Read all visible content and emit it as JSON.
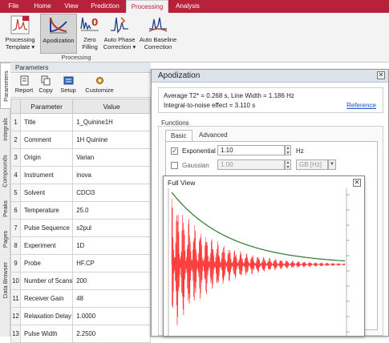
{
  "ribbon": {
    "tabs": [
      "File",
      "Home",
      "View",
      "Prediction",
      "Processing",
      "Analysis"
    ],
    "buttons": [
      "Processing Template ▾",
      "Apodization",
      "Zero Filling",
      "Auto Phase Correction ▾",
      "Auto Baseline Correction"
    ],
    "group_label": "Processing"
  },
  "side_tabs": [
    "Parameters",
    "Integrals",
    "Compounds",
    "Peaks",
    "Pages",
    "Data Browser"
  ],
  "params_panel": {
    "title": "Parameters",
    "toolbar": [
      "Report",
      "Copy",
      "Setup",
      "Customize"
    ],
    "columns": [
      "Parameter",
      "Value"
    ],
    "rows": [
      {
        "n": "1",
        "param": "Title",
        "value": "1_Quinine1H"
      },
      {
        "n": "2",
        "param": "Comment",
        "value": "1H Quinine"
      },
      {
        "n": "3",
        "param": "Origin",
        "value": "Varian"
      },
      {
        "n": "4",
        "param": "Instrument",
        "value": "inova"
      },
      {
        "n": "5",
        "param": "Solvent",
        "value": "CDCl3"
      },
      {
        "n": "6",
        "param": "Temperature",
        "value": "25.0"
      },
      {
        "n": "7",
        "param": "Pulse Sequence",
        "value": "s2pul"
      },
      {
        "n": "8",
        "param": "Experiment",
        "value": "1D"
      },
      {
        "n": "9",
        "param": "Probe",
        "value": "HF.CP"
      },
      {
        "n": "10",
        "param": "Number of Scans",
        "value": "200"
      },
      {
        "n": "11",
        "param": "Receiver Gain",
        "value": "48"
      },
      {
        "n": "12",
        "param": "Relaxation Delay",
        "value": "1.0000"
      },
      {
        "n": "13",
        "param": "Pulse Width",
        "value": "2.2500"
      }
    ]
  },
  "apodization": {
    "title": "Apodization",
    "info_line1": "Average T2* = 0.268 s, Line Width = 1.186 Hz",
    "info_line2": "Integral-to-noise effect = 3.110 s",
    "reference": "Reference",
    "functions_label": "Functions",
    "subtabs": [
      "Basic",
      "Advanced"
    ],
    "exponential": {
      "label": "Exponential",
      "value": "1.10",
      "unit": "Hz",
      "checked": true
    },
    "gaussian": {
      "label": "Gaussian",
      "value": "1.00",
      "unit": "GB [Hz]",
      "checked": false
    }
  },
  "full_view": {
    "title": "Full View",
    "y_ticks": [
      "",
      "",
      "",
      "",
      "",
      "",
      "",
      "",
      "",
      ""
    ]
  },
  "colors": {
    "brand": "#b8213a",
    "fid": "#ff2a2a",
    "envelope": "#2f7a2f"
  }
}
